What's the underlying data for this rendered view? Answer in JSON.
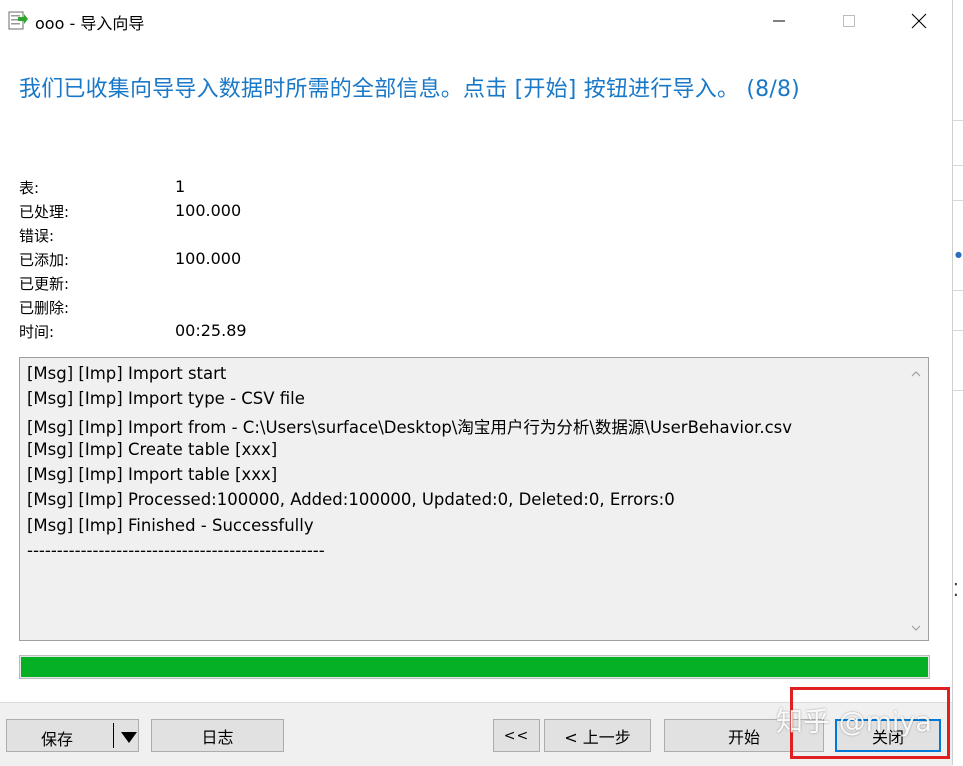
{
  "window": {
    "title": "ooo - 导入向导"
  },
  "heading": "我们已收集向导导入数据时所需的全部信息。点击 [开始] 按钮进行导入。 (8/8)",
  "stats": [
    {
      "label": "表:",
      "value": "1"
    },
    {
      "label": "已处理:",
      "value": "100.000"
    },
    {
      "label": "错误:",
      "value": ""
    },
    {
      "label": "已添加:",
      "value": "100.000"
    },
    {
      "label": "已更新:",
      "value": ""
    },
    {
      "label": "已删除:",
      "value": ""
    },
    {
      "label": "时间:",
      "value": "00:25.89"
    }
  ],
  "log": [
    "[Msg] [Imp] Import start",
    "[Msg] [Imp] Import type - CSV file",
    "[Msg] [Imp] Import from - C:\\Users\\surface\\Desktop\\淘宝用户行为分析\\数据源\\UserBehavior.csv",
    "[Msg] [Imp] Create table [xxx]",
    "[Msg] [Imp] Import table [xxx]",
    "[Msg] [Imp] Processed:100000, Added:100000, Updated:0, Deleted:0, Errors:0",
    "[Msg] [Imp] Finished - Successfully",
    "--------------------------------------------------"
  ],
  "progress": {
    "fraction": 1.0,
    "color": "#06b025"
  },
  "buttons": {
    "save": "保存",
    "log": "日志",
    "first": "<<",
    "prev": "< 上一步",
    "start": "开始",
    "close": "关闭"
  },
  "watermark": "知乎 @miya",
  "colors": {
    "heading": "#1a78c8",
    "highlight": "#e02020"
  }
}
